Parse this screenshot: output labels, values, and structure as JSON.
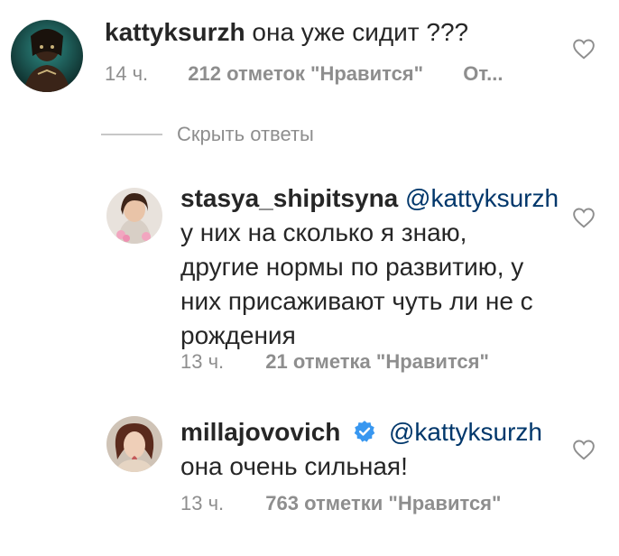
{
  "comments": [
    {
      "username": "kattyksurzh",
      "text": "она уже сидит ???",
      "time": "14 ч.",
      "likes": "212 отметок \"Нравится\"",
      "reply": "От..."
    },
    {
      "username": "stasya_shipitsyna",
      "mention": "@kattyksurzh",
      "lines": [
        "у них на сколько я знаю,",
        "другие нормы по развитию, у",
        "них присаживают чуть ли не с",
        "рождения"
      ],
      "time": "13 ч.",
      "likes": "21 отметка \"Нравится\""
    },
    {
      "username": "millajovovich",
      "verified": true,
      "mention": "@kattyksurzh",
      "text": "она очень сильная!",
      "time": "13 ч.",
      "likes": "763 отметки \"Нравится\""
    }
  ],
  "hide_replies": "Скрыть ответы",
  "colors": {
    "text": "#262626",
    "secondary": "#8e8e8e",
    "mention": "#00376b",
    "verified": "#3897f0"
  },
  "icons": [
    "heart-outline-icon",
    "verified-badge-icon"
  ]
}
